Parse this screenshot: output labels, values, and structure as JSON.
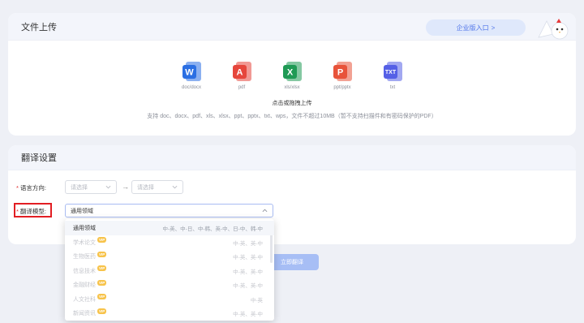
{
  "upload": {
    "title": "文件上传",
    "enterprise_label": "企业版入口",
    "enterprise_chevron": ">",
    "formats": [
      {
        "label": "doc/docx",
        "icon": "word-icon",
        "color": "#2b6fe3",
        "mark": "W"
      },
      {
        "label": "pdf",
        "icon": "pdf-icon",
        "color": "#e6463c",
        "mark": "A"
      },
      {
        "label": "xls/xlsx",
        "icon": "excel-icon",
        "color": "#1f9a55",
        "mark": "X"
      },
      {
        "label": "ppt/pptx",
        "icon": "ppt-icon",
        "color": "#e8533a",
        "mark": "P"
      },
      {
        "label": "txt",
        "icon": "txt-icon",
        "color": "#5560e6",
        "mark": "TXT"
      }
    ],
    "cta": "点击或拖拽上传",
    "hint": "支持 doc、docx、pdf、xls、xlsx、ppt、pptx、txt、wps，文件不超过10MB（暂不支持扫描件和有密码保护的PDF）"
  },
  "settings": {
    "title": "翻译设置",
    "language_label": "语言方向:",
    "source_placeholder": "请选择",
    "target_placeholder": "请选择",
    "direction_arrow": "→",
    "model_label": "翻译模型:",
    "model_value": "通用领域"
  },
  "dropdown": {
    "items": [
      {
        "name": "通用领域",
        "langs": "中-英、中-日、中-韩、英-中、日-中、韩-中",
        "vip": false,
        "active": true
      },
      {
        "name": "学术论文",
        "langs": "中-英、英-中",
        "vip": true,
        "active": false
      },
      {
        "name": "生物医药",
        "langs": "中-英、英-中",
        "vip": true,
        "active": false
      },
      {
        "name": "信息技术",
        "langs": "中-英、英-中",
        "vip": true,
        "active": false
      },
      {
        "name": "金融财经",
        "langs": "中-英、英-中",
        "vip": true,
        "active": false
      },
      {
        "name": "人文社科",
        "langs": "中-英",
        "vip": true,
        "active": false
      },
      {
        "name": "新闻资讯",
        "langs": "中-英、英-中",
        "vip": true,
        "active": false
      }
    ],
    "vip_label": "VIP"
  },
  "actions": {
    "translate_label": "立即翻译"
  },
  "colors": {
    "accent": "#4f74e9",
    "button_disabled": "#a7bef5",
    "highlight_box": "#e21e23"
  }
}
